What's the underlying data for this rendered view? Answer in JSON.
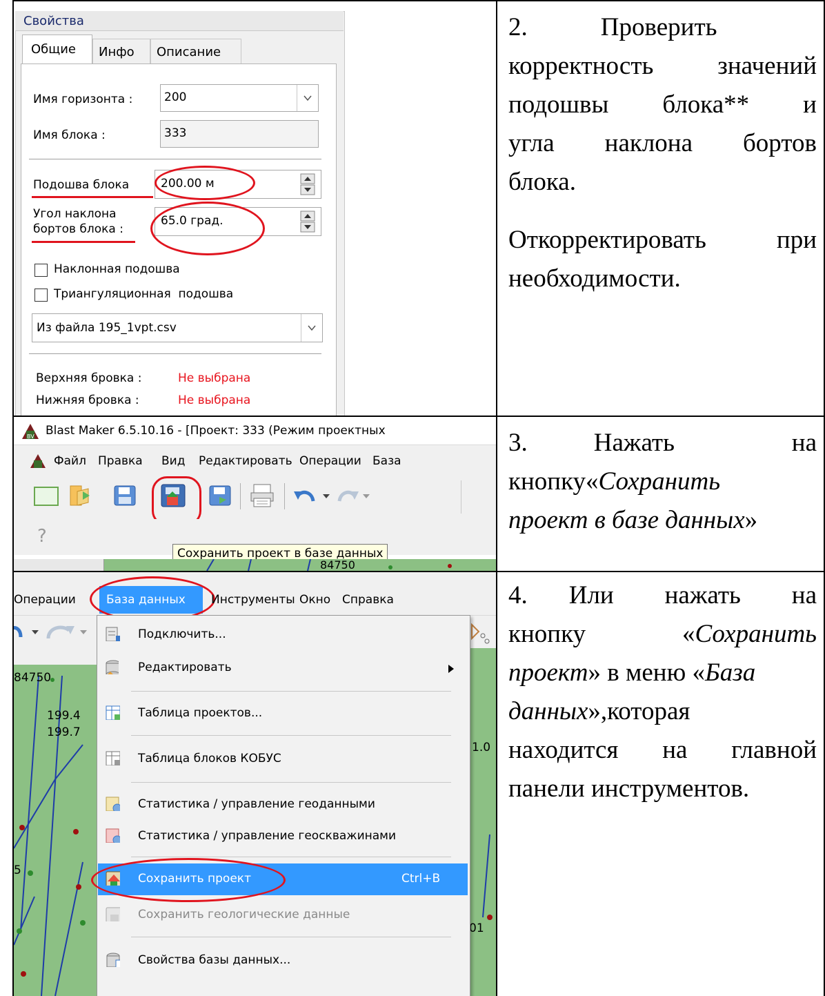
{
  "row1": {
    "panel_title": "Свойства",
    "tabs": [
      "Общие",
      "Инфо",
      "Описание"
    ],
    "horizon_label": "Имя горизонта :",
    "horizon_value": "200",
    "block_label": "Имя блока :",
    "block_value": "333",
    "sole_label": "Подошва блока",
    "sole_value": "200.00 м",
    "angle_label_1": "Угол наклона",
    "angle_label_2": "бортов блока :",
    "angle_value": "65.0 град.",
    "check1": "Наклонная подошва",
    "check2": "Триангуляционная  подошва",
    "file_value": "Из файла 195_1vpt.csv",
    "upper_label": "Верхняя бровка :",
    "upper_value": "Не выбрана",
    "lower_label": "Нижняя бровка :",
    "lower_value": "Не выбрана",
    "step": {
      "num": "2.",
      "l1": "Проверить",
      "l2": "корректность значений",
      "l3a": "подошвы",
      "l3b": "блока**",
      "l3c": "и",
      "l4a": "угла",
      "l4b": "наклона",
      "l4c": "бортов",
      "l5": "блока.",
      "l6a": "Откорректировать",
      "l6b": "при",
      "l7": "необходимости."
    }
  },
  "row2": {
    "window_title": "Blast Maker 6.5.10.16 - [Проект: 333 (Режим проектных",
    "menu": [
      "Файл",
      "Правка",
      "Вид",
      "Редактировать",
      "Операции",
      "База"
    ],
    "help_glyph": "?",
    "tooltip": "Сохранить проект в базе данных",
    "map_number": "84750",
    "step": {
      "num": "3.",
      "verb": "Нажать",
      "prep": "на",
      "l2a": "кнопку«",
      "l2b": "Сохранить",
      "l3a": "проект в базе данных",
      "l3b": "»"
    }
  },
  "row3": {
    "menubar": [
      "Операции",
      "База данных",
      "Инструменты",
      "Окно",
      "Справка"
    ],
    "menu_items": [
      "Подключить...",
      "Редактировать",
      "Таблица проектов...",
      "Таблица блоков КОБУС",
      "Статистика / управление геоданными",
      "Статистика / управление геоскважинами",
      "Сохранить проект",
      "Сохранить геологические данные",
      "Свойства базы данных..."
    ],
    "shortcut": "Ctrl+B",
    "map_labels": [
      "84750",
      "199.4",
      "199.7",
      "1.0",
      "01",
      "5"
    ],
    "step": {
      "num": "4.",
      "w1": "Или",
      "w2": "нажать",
      "w3": "на",
      "w4": "кнопку",
      "w5a": "«",
      "w5b": "Сохранить",
      "w6": "проект",
      "w7a": "» в меню «",
      "w7b": "База",
      "w8": "данных",
      "w9": "»,которая",
      "w10": "находится на главной",
      "w11": "панели инструментов."
    }
  }
}
